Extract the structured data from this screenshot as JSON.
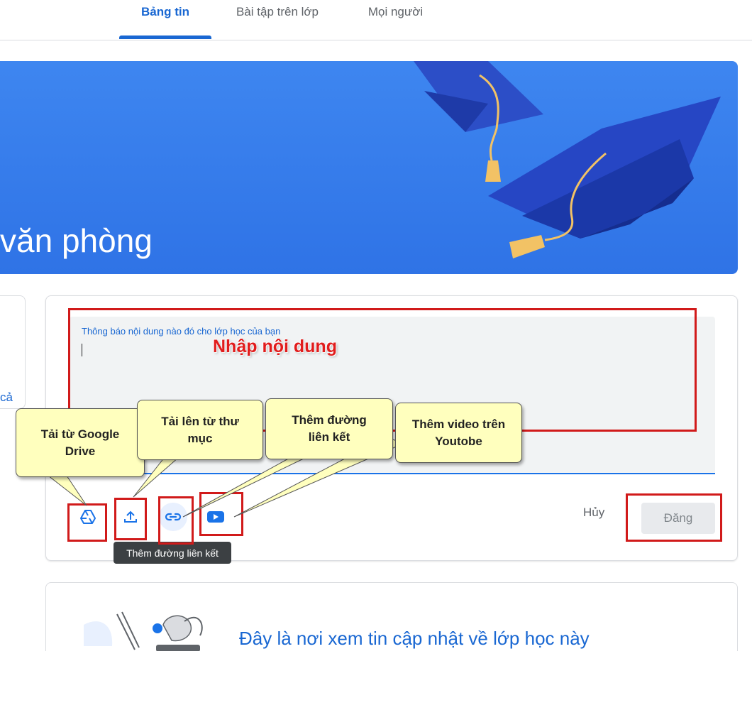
{
  "tabs": [
    {
      "label": "Bảng tin",
      "active": true
    },
    {
      "label": "Bài tập trên lớp",
      "active": false
    },
    {
      "label": "Mọi người",
      "active": false
    }
  ],
  "banner": {
    "title_partial": "văn phòng"
  },
  "left_card": {
    "partial_text": "cả"
  },
  "composer": {
    "label": "Thông báo nội dung nào đó cho lớp học của bạn",
    "cancel": "Hủy",
    "post": "Đăng"
  },
  "tooltip": "Thêm đường liên kết",
  "annotations": {
    "input_label": "Nhập nội dung",
    "drive": "Tải từ Google Drive",
    "upload": "Tải lên từ thư mục",
    "link": "Thêm đường liên kết",
    "youtube": "Thêm video trên Youtobe"
  },
  "empty_state": {
    "text": "Đây là nơi xem tin cập nhật về lớp học này"
  },
  "icons": [
    "google-drive-icon",
    "upload-icon",
    "link-icon",
    "youtube-icon"
  ],
  "colors": {
    "accent": "#1967d2",
    "banner": "#3e86f0",
    "annotation_red": "#d11a1a",
    "callout_bg": "#ffffbe"
  }
}
